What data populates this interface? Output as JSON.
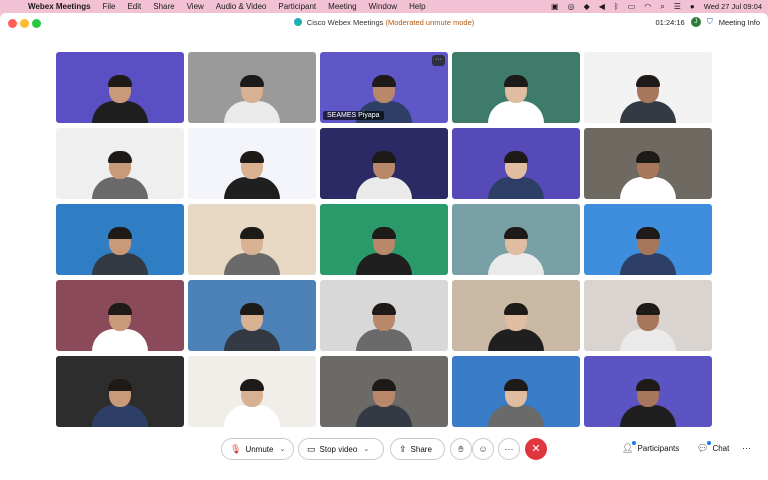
{
  "menubar": {
    "items": [
      "Webex Meetings",
      "File",
      "Edit",
      "Share",
      "View",
      "Audio & Video",
      "Participant",
      "Meeting",
      "Window",
      "Help"
    ],
    "clock": "Wed 27 Jul  09:04"
  },
  "window": {
    "title_app": "Cisco Webex Meetings",
    "title_mode": "(Moderated unmute mode)",
    "elapsed": "01:24:16",
    "avatar_initial": "J",
    "meeting_info": "Meeting Info"
  },
  "tiles": [
    {
      "name": "",
      "bg": "#5b4fc4"
    },
    {
      "name": "",
      "bg": "#9a9a9a"
    },
    {
      "name": "SEAMES Piyapa",
      "bg": "#5f56c8",
      "more": "···"
    },
    {
      "name": "",
      "bg": "#3f7b6a"
    },
    {
      "name": "",
      "bg": "#f2f2f2"
    },
    {
      "name": "",
      "bg": "#efefef"
    },
    {
      "name": "",
      "bg": "#f3f5fa"
    },
    {
      "name": "",
      "bg": "#2c2a64"
    },
    {
      "name": "",
      "bg": "#564ab8"
    },
    {
      "name": "",
      "bg": "#6e6a62"
    },
    {
      "name": "",
      "bg": "#2f7dc2"
    },
    {
      "name": "",
      "bg": "#e8d9c4"
    },
    {
      "name": "",
      "bg": "#2a9a6a"
    },
    {
      "name": "",
      "bg": "#79a0a6"
    },
    {
      "name": "",
      "bg": "#3f8ede"
    },
    {
      "name": "",
      "bg": "#8b4a5a"
    },
    {
      "name": "",
      "bg": "#4d82b8"
    },
    {
      "name": "",
      "bg": "#d8d8d8"
    },
    {
      "name": "",
      "bg": "#c9b8a4"
    },
    {
      "name": "",
      "bg": "#d9d4d0"
    },
    {
      "name": "",
      "bg": "#2d2d2d"
    },
    {
      "name": "",
      "bg": "#f1eee9"
    },
    {
      "name": "",
      "bg": "#6c6a66"
    },
    {
      "name": "",
      "bg": "#3b7cc8"
    },
    {
      "name": "",
      "bg": "#5c54c3"
    }
  ],
  "controls": {
    "unmute": "Unmute",
    "stop_video": "Stop video",
    "share": "Share",
    "participants": "Participants",
    "chat": "Chat",
    "more": "⋯"
  }
}
